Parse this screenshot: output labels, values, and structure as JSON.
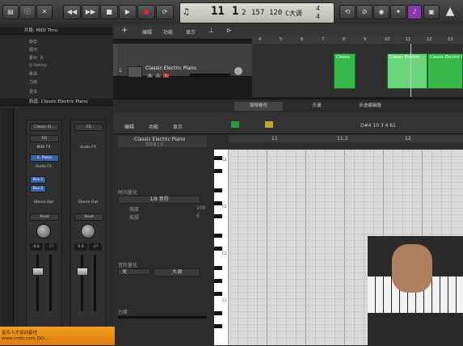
{
  "control_bar": {
    "buttons": [
      "◀◀",
      "▶▶",
      "■",
      "▶",
      "●",
      "⟳"
    ],
    "lcd": {
      "bar": "11",
      "beat": "1",
      "sub": "2",
      "tempo": "157",
      "div": "120",
      "key": "C大调",
      "sig_top": "4",
      "sig_bot": "4"
    }
  },
  "inspector": {
    "region_header": "片段: MIDI Thru",
    "region_params": [
      "静音:",
      "循环:",
      "量化: 关",
      "Q-Swing:",
      "移调:",
      "力度:"
    ],
    "more_label": "更多",
    "track_header": "轨道: Classic Electric Piano",
    "strip_left": {
      "preset": "Classic El...",
      "eq": "EQ",
      "midi_fx": "MIDI FX",
      "instrument": "E. Piano",
      "audio_fx": "Audio FX",
      "sends": [
        "Bus 1",
        "Bus 2"
      ],
      "output": "Stereo Out",
      "automation": "Read",
      "pan_value": "0.0",
      "meter_value": "-27"
    },
    "strip_right": {
      "eq": "EQ",
      "midi_fx": "Audio FX",
      "output": "Stereo Out",
      "automation": "Read",
      "pan_value": "0.0",
      "meter_value": "-27"
    }
  },
  "tracks_header": {
    "menus": [
      "编辑",
      "功能",
      "显示"
    ]
  },
  "track": {
    "number": "1",
    "name": "Classic Electric Piano",
    "m": "M",
    "s": "S",
    "r": "R"
  },
  "ruler_marks": [
    "4",
    "5",
    "6",
    "7",
    "8",
    "9",
    "10",
    "11",
    "12",
    "13",
    "14"
  ],
  "regions": [
    {
      "label": "Classic"
    },
    {
      "label": "Classic Electric"
    },
    {
      "label": "Classic Electric Piano"
    }
  ],
  "editor": {
    "tabs": [
      "钢琴卷帘",
      "乐谱",
      "步进编辑器"
    ],
    "menus": [
      "编辑",
      "功能",
      "显示"
    ],
    "region_name": "Classic Electric Piano",
    "region_sub": "在轨道上方",
    "position_readout": "D#4  10 3 4 61",
    "ruler": [
      "11",
      "11.3",
      "12"
    ],
    "time_quantize_label": "时间量化",
    "time_quantize_value": "1/8 音符",
    "strength_label": "强度",
    "strength_value": "100",
    "swing_label": "摇摆",
    "swing_value": "0",
    "scale_quantize_label": "音阶量化",
    "scale_value_1": "关",
    "scale_value_2": "大调",
    "velocity_label": "力度",
    "velocity_value": "80",
    "key_labels": [
      "C4",
      "C3",
      "C2",
      "C1"
    ]
  },
  "banner": {
    "line1": "音乐人才培训基地",
    "line2": "www.cmtc.com  QQ:..."
  }
}
